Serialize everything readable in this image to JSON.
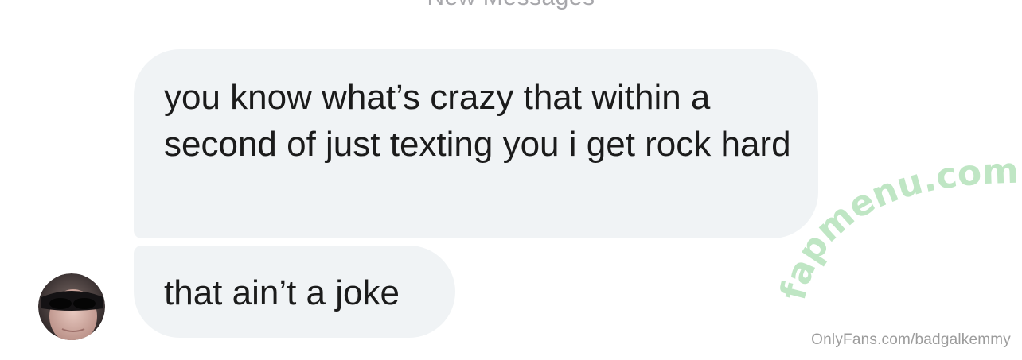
{
  "thread": {
    "section_label": "New Messages"
  },
  "messages": [
    {
      "text": "you know what’s crazy that within a second of just texting you i get rock hard"
    },
    {
      "text": "that ain’t a joke"
    }
  ],
  "watermark": {
    "text": "fapmenu.com",
    "color": "#bfe6c4"
  },
  "credit": {
    "text": "OnlyFans.com/badgalkemmy"
  },
  "colors": {
    "bubble": "#f0f3f5",
    "text": "#1b1b1b",
    "muted": "#a7a7ab"
  }
}
